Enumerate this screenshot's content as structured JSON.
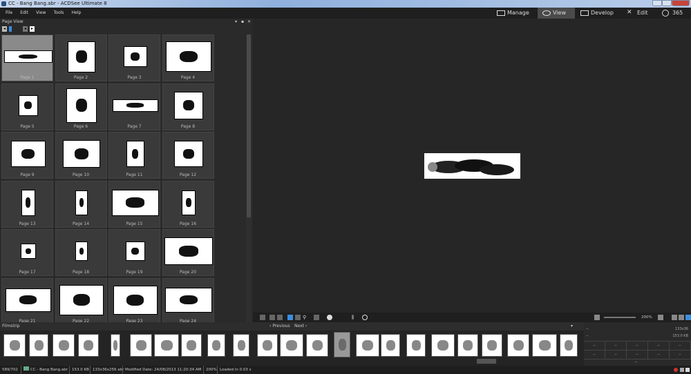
{
  "window": {
    "title": "CC - Bang Bang.abr - ACDSee Ultimate 8"
  },
  "menu": [
    "File",
    "Edit",
    "View",
    "Tools",
    "Help"
  ],
  "modes": [
    {
      "label": "Manage",
      "icon": "grid-icon"
    },
    {
      "label": "View",
      "icon": "eye-icon",
      "active": true
    },
    {
      "label": "Develop",
      "icon": "develop-icon"
    },
    {
      "label": "Edit",
      "icon": "tools-icon"
    },
    {
      "label": "365",
      "icon": "365-icon"
    }
  ],
  "page_view": {
    "title": "Page View",
    "pages": [
      "Page 1",
      "Page 2",
      "Page 3",
      "Page 4",
      "Page 5",
      "Page 6",
      "Page 7",
      "Page 8",
      "Page 9",
      "Page 10",
      "Page 11",
      "Page 12",
      "Page 13",
      "Page 14",
      "Page 15",
      "Page 16",
      "Page 17",
      "Page 18",
      "Page 19",
      "Page 20",
      "Page 21",
      "Page 22",
      "Page 23",
      "Page 24"
    ],
    "selected": "Page 1"
  },
  "viewer": {
    "zoom": "200%"
  },
  "filmstrip": {
    "title": "Filmstrip",
    "previous": "Previous",
    "next": "Next",
    "count": 23,
    "selected_index": 13
  },
  "info": {
    "dimensions": "133x36",
    "size": "153.0 KB",
    "placeholder": "--"
  },
  "status": {
    "position": "589/702",
    "file": "CC - Bang Bang.abr",
    "size": "153.0 KB",
    "details": "133x36x256 abr",
    "modified": "Modified Date: 24/08/2013 11:20:34 AM",
    "zoom": "200%",
    "loaded": "Loaded in 0.03 s"
  }
}
